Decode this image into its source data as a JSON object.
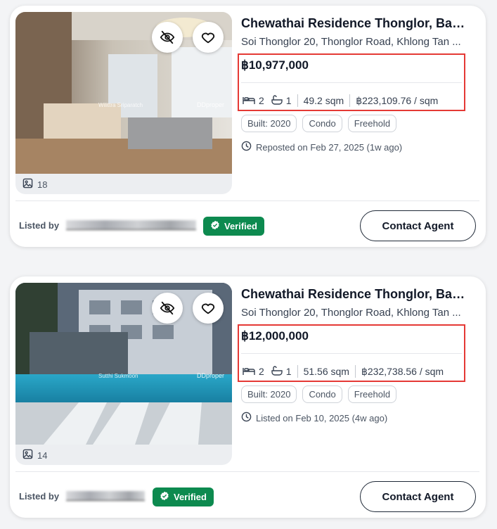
{
  "listings": [
    {
      "title": "Chewathai Residence Thonglor, Ban...",
      "address": "Soi Thonglor 20, Thonglor Road, Khlong Tan ...",
      "price": "฿10,977,000",
      "beds": "2",
      "baths": "1",
      "area": "49.2 sqm",
      "price_per_sqm": "฿223,109.76 / sqm",
      "tags": [
        "Built: 2020",
        "Condo",
        "Freehold"
      ],
      "posted": "Reposted on Feb 27, 2025 (1w ago)",
      "photo_count": "18",
      "photo_watermark": "Wilittra Sriparatch",
      "watermark_brand": "DDproper",
      "listed_by_label": "Listed by",
      "verified_label": "Verified",
      "contact_label": "Contact Agent"
    },
    {
      "title": "Chewathai Residence Thonglor, Ban...",
      "address": "Soi Thonglor 20, Thonglor Road, Khlong Tan ...",
      "price": "฿12,000,000",
      "beds": "2",
      "baths": "1",
      "area": "51.56 sqm",
      "price_per_sqm": "฿232,738.56 / sqm",
      "tags": [
        "Built: 2020",
        "Condo",
        "Freehold"
      ],
      "posted": "Listed on Feb 10, 2025 (4w ago)",
      "photo_count": "14",
      "photo_watermark": "Sutthi Sukmoon",
      "watermark_brand": "DDproper",
      "listed_by_label": "Listed by",
      "verified_label": "Verified",
      "contact_label": "Contact Agent"
    }
  ],
  "colors": {
    "highlight_box": "#e53935",
    "verified_badge": "#0d8a4f"
  }
}
